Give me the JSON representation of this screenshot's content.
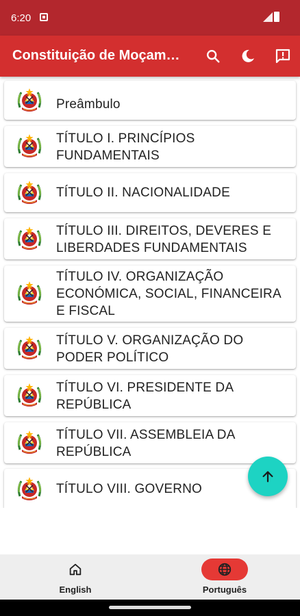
{
  "status_bar": {
    "time": "6:20"
  },
  "app_bar": {
    "title": "Constituição de Moçambique",
    "actions": [
      "search-icon",
      "moon-icon",
      "feedback-icon"
    ]
  },
  "items": [
    {
      "label": "Preâmbulo"
    },
    {
      "label": "TÍTULO I. PRINCÍPIOS FUNDAMENTAIS"
    },
    {
      "label": "TÍTULO II. NACIONALIDADE"
    },
    {
      "label": "TÍTULO III. DIREITOS, DEVERES E LIBERDADES FUNDAMENTAIS"
    },
    {
      "label": "TÍTULO IV. ORGANIZAÇÃO ECONÓMICA, SOCIAL, FINANCEIRA E FISCAL"
    },
    {
      "label": "TÍTULO V. ORGANIZAÇÃO DO PODER POLÍTICO"
    },
    {
      "label": "TÍTULO VI. PRESIDENTE DA REPÚBLICA"
    },
    {
      "label": "TÍTULO VII. ASSEMBLEIA DA REPÚBLICA"
    },
    {
      "label": "TÍTULO VIII. GOVERNO"
    }
  ],
  "fab": {
    "icon": "arrow-up-icon"
  },
  "bottom_nav": [
    {
      "label": "English",
      "icon": "home-icon",
      "selected": false
    },
    {
      "label": "Português",
      "icon": "globe-icon",
      "selected": true
    }
  ],
  "colors": {
    "status_bar": "#b3272d",
    "app_bar": "#d32f2f",
    "fab": "#1dd3c3",
    "nav_active": "#e53935"
  }
}
